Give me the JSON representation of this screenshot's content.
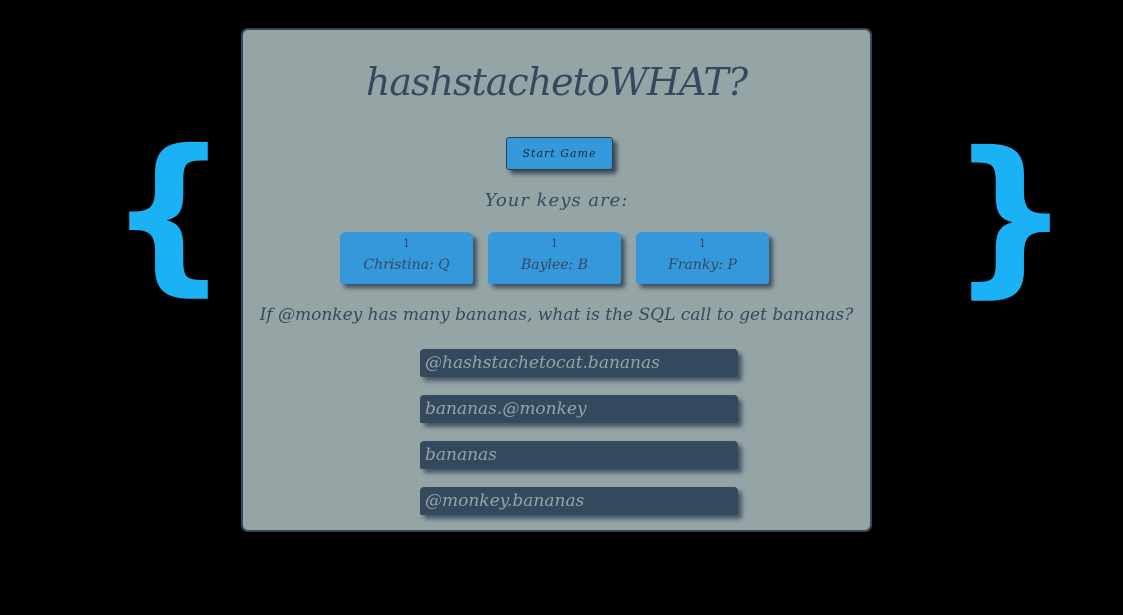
{
  "braces": {
    "left": "{",
    "right": "}"
  },
  "game": {
    "title": "hashstachetoWHAT?",
    "start_label": "Start Game",
    "keys_label": "Your keys are:",
    "keys": [
      {
        "count": "1",
        "name": "Christina: Q"
      },
      {
        "count": "1",
        "name": "Baylee: B"
      },
      {
        "count": "1",
        "name": "Franky: P"
      }
    ],
    "question": "If @monkey has many bananas, what is the SQL call to get bananas?",
    "answers": [
      "@hashstachetocat.bananas",
      "bananas.@monkey",
      "bananas",
      "@monkey.bananas"
    ]
  },
  "colors": {
    "background": "#000000",
    "brace": "#1ab2f4",
    "panel": "#95a5a6",
    "accent": "#3498db",
    "dark": "#34495e"
  }
}
